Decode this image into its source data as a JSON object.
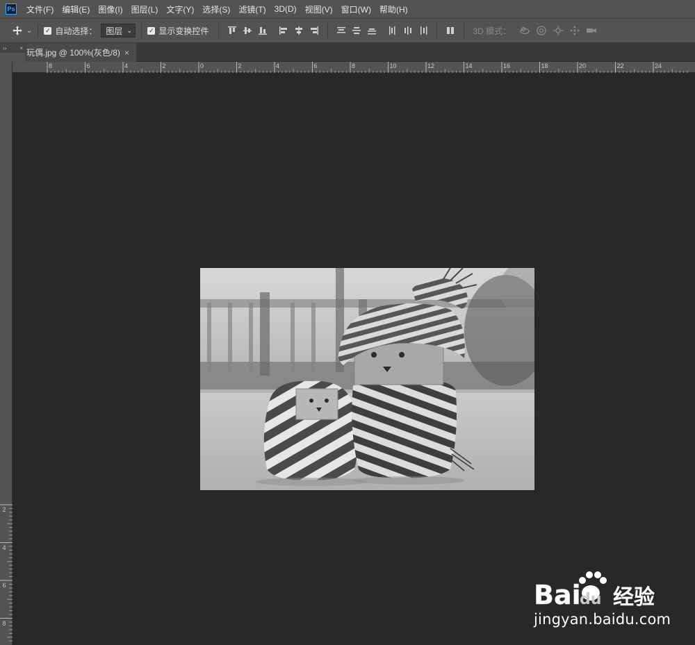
{
  "app": {
    "logo": "Ps"
  },
  "menu": [
    "文件(F)",
    "编辑(E)",
    "图像(I)",
    "图层(L)",
    "文字(Y)",
    "选择(S)",
    "滤镜(T)",
    "3D(D)",
    "视图(V)",
    "窗口(W)",
    "帮助(H)"
  ],
  "options": {
    "auto_select_label": "自动选择：",
    "layer_select_value": "图层",
    "show_transform_label": "显示变换控件",
    "mode3d_label": "3D 模式："
  },
  "document_tab": {
    "title": "玩偶.jpg @ 100%(灰色/8) *",
    "close": "×"
  },
  "ruler_top": [
    "8",
    "6",
    "4",
    "2",
    "0",
    "2",
    "4",
    "6",
    "8",
    "10",
    "12",
    "14",
    "16",
    "18",
    "20",
    "22",
    "24"
  ],
  "ruler_left": [
    "2",
    "4",
    "6",
    "8"
  ],
  "toolbar_header": {
    "collapse": "››",
    "close": "×"
  },
  "tools": [
    "move-tool",
    "marquee-tool",
    "lasso-tool",
    "magic-wand-tool",
    "crop-tool",
    "eyedropper-tool",
    "healing-brush-tool",
    "brush-tool",
    "clone-stamp-tool",
    "history-brush-tool",
    "eraser-tool",
    "gradient-tool",
    "blur-tool",
    "dodge-tool",
    "pen-tool",
    "type-tool",
    "path-selection-tool",
    "ellipse-tool",
    "hand-tool",
    "zoom-tool",
    "more-tools"
  ],
  "colors": {
    "foreground": "#ffffff",
    "background": "#000000",
    "ui_panel": "#535353",
    "canvas": "#282828"
  },
  "watermark": {
    "brand": "Bai 经验",
    "url": "jingyan.baidu.com"
  }
}
